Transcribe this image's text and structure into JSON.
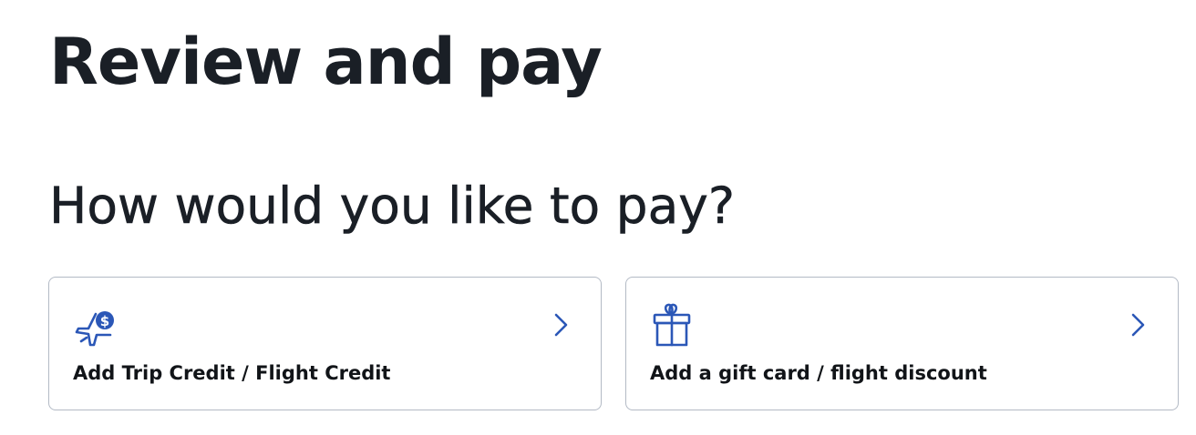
{
  "page": {
    "title": "Review and pay"
  },
  "payment": {
    "heading": "How would you like to pay?",
    "options": [
      {
        "label": "Add Trip Credit / Flight Credit",
        "icon": "plane-dollar-icon"
      },
      {
        "label": "Add a gift card / flight discount",
        "icon": "gift-icon"
      }
    ]
  },
  "colors": {
    "text": "#1a1f26",
    "accent": "#2b57b7",
    "card_border": "#b3bac5"
  }
}
